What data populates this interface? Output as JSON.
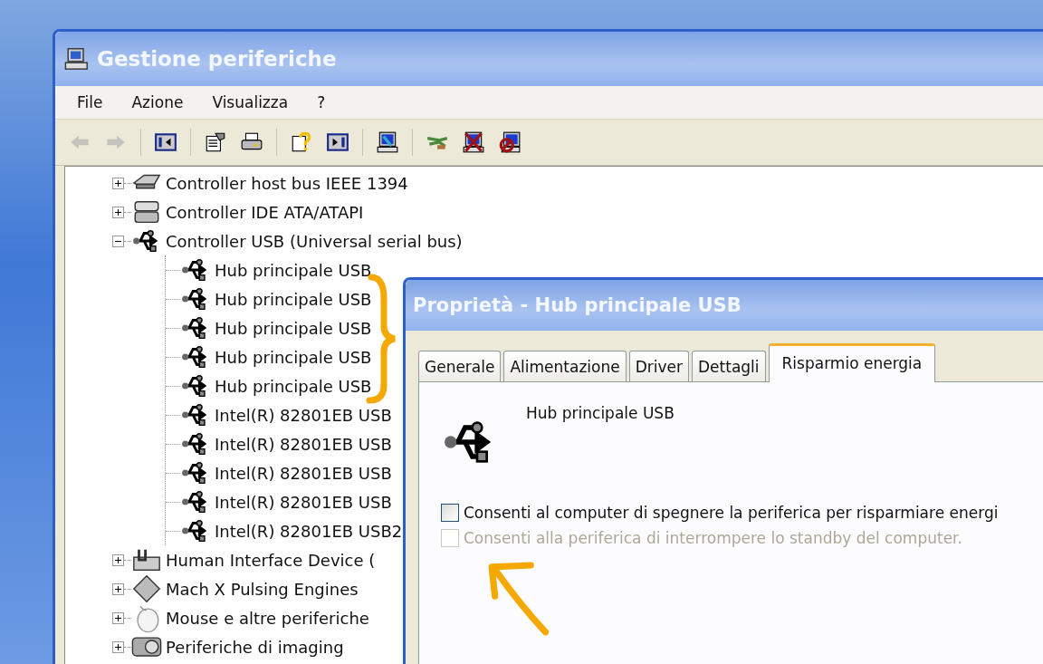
{
  "window": {
    "title": "Gestione periferiche"
  },
  "menu": [
    "File",
    "Azione",
    "Visualizza",
    "?"
  ],
  "toolbar": [
    {
      "kind": "back",
      "disabled": true
    },
    {
      "kind": "forward",
      "disabled": true
    },
    {
      "kind": "separator"
    },
    {
      "kind": "tree-pane"
    },
    {
      "kind": "separator"
    },
    {
      "kind": "properties"
    },
    {
      "kind": "print"
    },
    {
      "kind": "separator"
    },
    {
      "kind": "help"
    },
    {
      "kind": "action-pane"
    },
    {
      "kind": "separator"
    },
    {
      "kind": "scan"
    },
    {
      "kind": "separator"
    },
    {
      "kind": "plug"
    },
    {
      "kind": "uninstall"
    },
    {
      "kind": "disable"
    }
  ],
  "tree": [
    {
      "label": "Controller host bus IEEE 1394",
      "kind": "card",
      "expanded": false
    },
    {
      "label": "Controller IDE ATA/ATAPI",
      "kind": "drive",
      "expanded": false
    },
    {
      "label": "Controller USB (Universal serial bus)",
      "kind": "usb",
      "expanded": true,
      "children": [
        {
          "label": "Hub principale USB",
          "kind": "usb"
        },
        {
          "label": "Hub principale USB",
          "kind": "usb"
        },
        {
          "label": "Hub principale USB",
          "kind": "usb"
        },
        {
          "label": "Hub principale USB",
          "kind": "usb"
        },
        {
          "label": "Hub principale USB",
          "kind": "usb"
        },
        {
          "label": "Intel(R) 82801EB USB",
          "kind": "usb"
        },
        {
          "label": "Intel(R) 82801EB USB",
          "kind": "usb"
        },
        {
          "label": "Intel(R) 82801EB USB",
          "kind": "usb"
        },
        {
          "label": "Intel(R) 82801EB USB",
          "kind": "usb"
        },
        {
          "label": "Intel(R) 82801EB USB2",
          "kind": "usb"
        }
      ]
    },
    {
      "label": "Human Interface Device (",
      "kind": "keyboard",
      "expanded": false
    },
    {
      "label": "Mach  X Pulsing Engines",
      "kind": "diamond",
      "expanded": false
    },
    {
      "label": "Mouse e altre periferiche",
      "kind": "mouse",
      "expanded": false
    },
    {
      "label": "Periferiche di imaging",
      "kind": "camera",
      "expanded": false
    }
  ],
  "dialog": {
    "title": "Proprietà - Hub principale USB",
    "tabs": [
      {
        "label": "Generale",
        "selected": false
      },
      {
        "label": "Alimentazione",
        "selected": false
      },
      {
        "label": "Driver",
        "selected": false
      },
      {
        "label": "Dettagli",
        "selected": false
      },
      {
        "label": "Risparmio energia",
        "selected": true
      }
    ],
    "device_name": "Hub principale USB",
    "options": [
      {
        "label": "Consenti al computer di spegnere la periferica per risparmiare energi",
        "checked": false,
        "disabled": false
      },
      {
        "label": "Consenti alla periferica di interrompere lo standby del computer.",
        "checked": false,
        "disabled": true
      }
    ]
  }
}
